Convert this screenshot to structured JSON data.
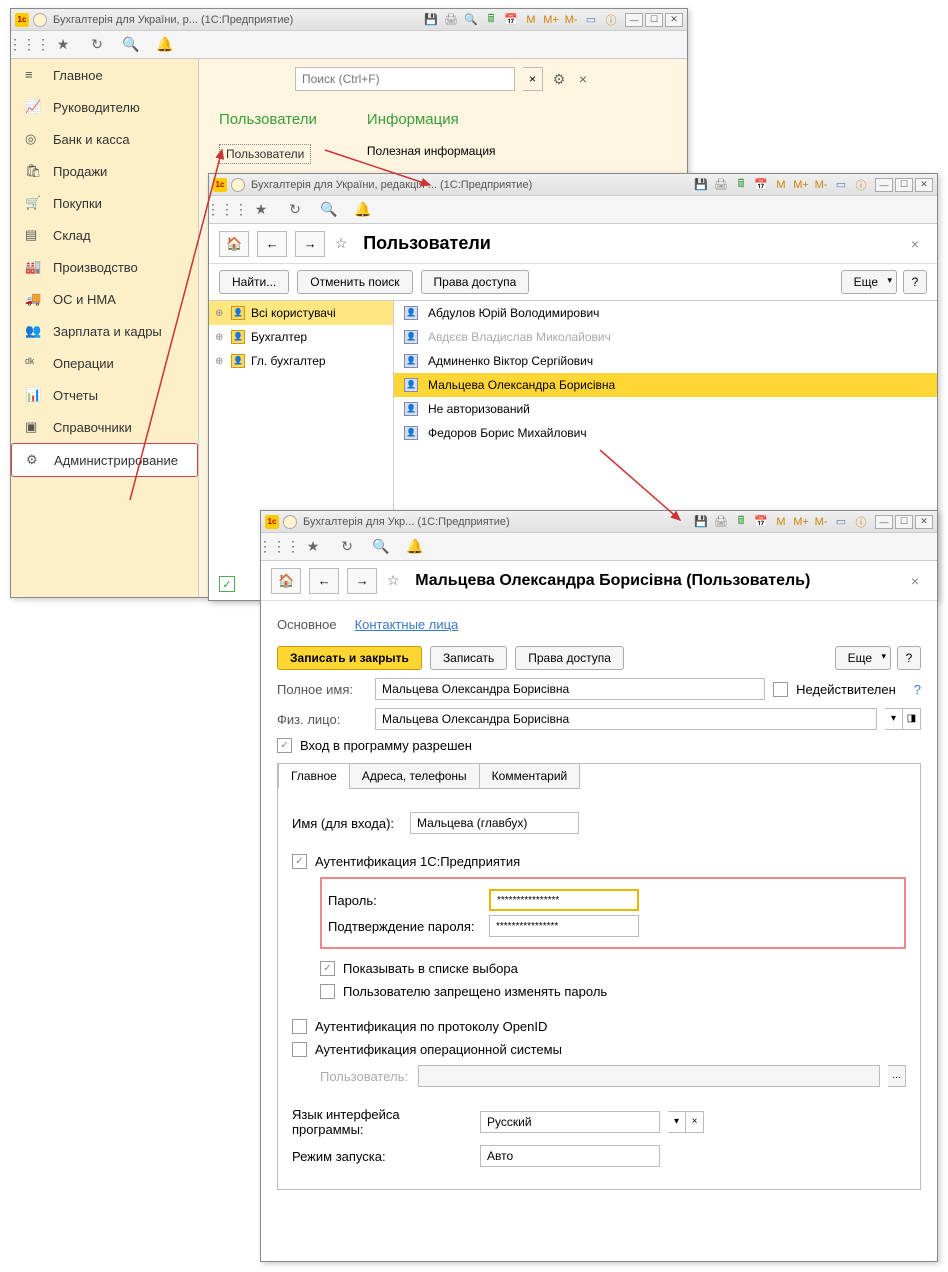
{
  "w1": {
    "title": "Бухгалтерія для України, р... (1С:Предприятие)",
    "search_placeholder": "Поиск (Ctrl+F)",
    "nav": [
      {
        "ico": "≡",
        "label": "Главное"
      },
      {
        "ico": "📈",
        "label": "Руководителю"
      },
      {
        "ico": "◎",
        "label": "Банк и касса"
      },
      {
        "ico": "🛍",
        "label": "Продажи"
      },
      {
        "ico": "🛒",
        "label": "Покупки"
      },
      {
        "ico": "▤",
        "label": "Склад"
      },
      {
        "ico": "🏭",
        "label": "Производство"
      },
      {
        "ico": "🚚",
        "label": "ОС и НМА"
      },
      {
        "ico": "👥",
        "label": "Зарплата и кадры"
      },
      {
        "ico": "ᵈᵏ",
        "label": "Операции"
      },
      {
        "ico": "📊",
        "label": "Отчеты"
      },
      {
        "ico": "▣",
        "label": "Справочники"
      },
      {
        "ico": "⚙",
        "label": "Администрирование"
      }
    ],
    "sec1": "Пользователи",
    "sec2": "Информация",
    "link": "Пользователи",
    "info": "Полезная информация"
  },
  "w2": {
    "title": "Бухгалтерія для України, редакція ... (1С:Предприятие)",
    "page": "Пользователи",
    "btn_find": "Найти...",
    "btn_cancel": "Отменить поиск",
    "btn_rights": "Права доступа",
    "btn_more": "Еще",
    "tree": [
      {
        "label": "Всі користувачі",
        "sel": true
      },
      {
        "label": "Бухгалтер"
      },
      {
        "label": "Гл. бухгалтер"
      }
    ],
    "users": [
      {
        "name": "Абдулов Юрій Володимирович"
      },
      {
        "name": "Авдєєв Владислав Миколайович",
        "dis": true
      },
      {
        "name": "Админенко Віктор Сергійович"
      },
      {
        "name": "Мальцева Олександра Борисівна",
        "sel": true
      },
      {
        "name": "Не авторизований"
      },
      {
        "name": "Федоров Борис Михайлович"
      }
    ]
  },
  "w3": {
    "title": "Бухгалтерія для Укр... (1С:Предприятие)",
    "page": "Мальцева Олександра Борисівна (Пользователь)",
    "tab_main": "Основное",
    "tab_contacts": "Контактные лица",
    "btn_save_close": "Записать и закрыть",
    "btn_save": "Записать",
    "btn_rights": "Права доступа",
    "btn_more": "Еще",
    "lbl_fullname": "Полное имя:",
    "val_fullname": "Мальцева Олександра Борисівна",
    "lbl_invalid": "Недействителен",
    "lbl_person": "Физ. лицо:",
    "val_person": "Мальцева Олександра Борисівна",
    "lbl_login_allowed": "Вход в программу разрешен",
    "tab1": "Главное",
    "tab2": "Адреса, телефоны",
    "tab3": "Комментарий",
    "lbl_login": "Имя (для входа):",
    "val_login": "Мальцева (главбух)",
    "lbl_auth1c": "Аутентификация 1С:Предприятия",
    "lbl_pw": "Пароль:",
    "val_pw": "****************",
    "lbl_pw2": "Подтверждение пароля:",
    "val_pw2": "****************",
    "lbl_show": "Показывать в списке выбора",
    "lbl_nochange": "Пользователю запрещено изменять пароль",
    "lbl_openid": "Аутентификация по протоколу OpenID",
    "lbl_osauth": "Аутентификация операционной системы",
    "lbl_osuser": "Пользователь:",
    "lbl_lang": "Язык интерфейса программы:",
    "val_lang": "Русский",
    "lbl_mode": "Режим запуска:",
    "val_mode": "Авто"
  }
}
